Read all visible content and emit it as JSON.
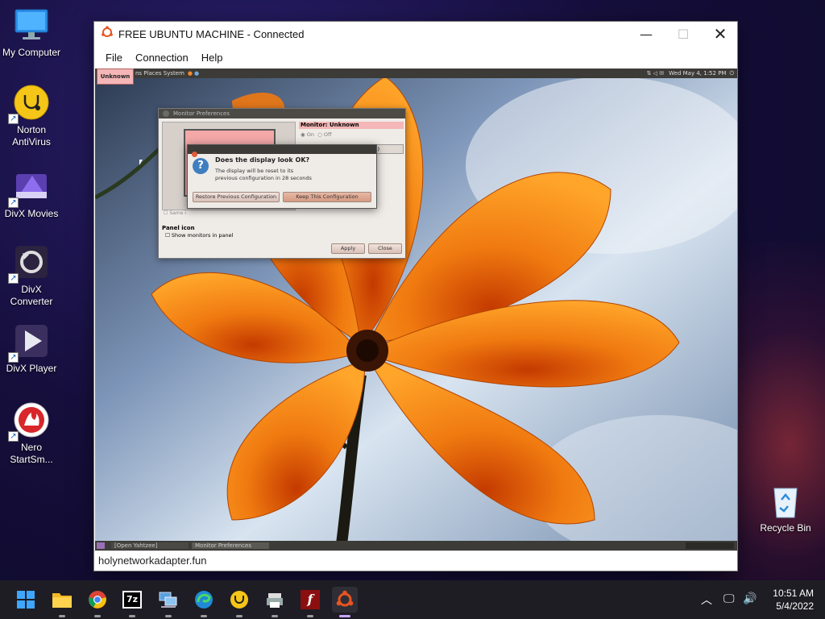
{
  "desktop": {
    "icons": [
      {
        "label": "My Computer"
      },
      {
        "label": "Norton AntiVirus"
      },
      {
        "label": "DivX Movies"
      },
      {
        "label": "DivX Converter"
      },
      {
        "label": "DivX Player"
      },
      {
        "label": "Nero StartSm..."
      },
      {
        "label": "Recycle Bin"
      }
    ]
  },
  "vm_window": {
    "title": "FREE UBUNTU MACHINE - Connected",
    "menu": [
      "File",
      "Connection",
      "Help"
    ],
    "status_text": "holynetworkadapter.fun"
  },
  "ubuntu": {
    "top_panel": {
      "menus": "ns  Places  System",
      "clock": "Wed May  4,  1:52 PM",
      "badge": "Unknown"
    },
    "monitor_prefs": {
      "title": "Monitor Preferences",
      "monitor_label": "Monitor: Unknown",
      "on_label": "On",
      "off_label": "Off",
      "resolution_partial": "4:3)",
      "same_image_label": "Same i",
      "panel_icon_heading": "Panel icon",
      "show_monitors_label": "Show monitors in panel",
      "apply_label": "Apply",
      "close_label": "Close"
    },
    "confirm_dialog": {
      "heading": "Does the display look OK?",
      "message_line1": "The display will be reset to its",
      "message_line2": "previous configuration in 28 seconds",
      "restore_label": "Restore Previous Configuration",
      "keep_label": "Keep This Configuration"
    },
    "bottom_panel": {
      "tasks": [
        "[Open Yahtzee]",
        "Monitor Preferences"
      ]
    }
  },
  "taskbar": {
    "apps": [
      {
        "name": "Start"
      },
      {
        "name": "File Explorer"
      },
      {
        "name": "Google Chrome"
      },
      {
        "name": "7-Zip"
      },
      {
        "name": "Network"
      },
      {
        "name": "Microsoft Edge"
      },
      {
        "name": "Norton"
      },
      {
        "name": "Printer"
      },
      {
        "name": "Flash"
      },
      {
        "name": "Ubuntu VM"
      }
    ],
    "time": "10:51 AM",
    "date": "5/4/2022"
  },
  "colors": {
    "ubuntu_orange": "#e95420",
    "ubuntu_panel": "#3c3b37",
    "unknown_badge": "#f4b6b6"
  }
}
